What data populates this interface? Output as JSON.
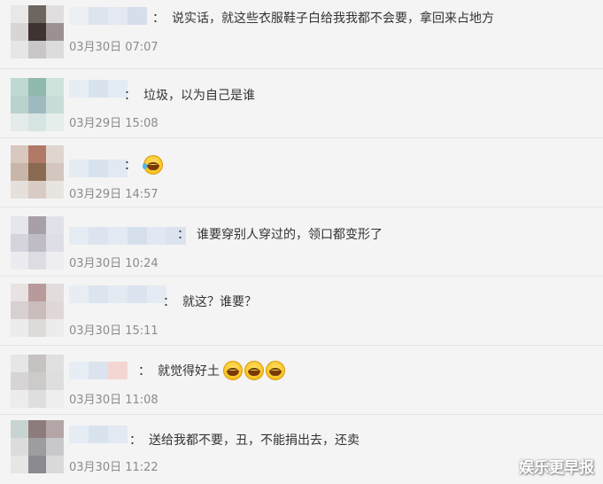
{
  "comments": [
    {
      "text": "说实话，就这些衣服鞋子白给我我都不会要，拿回来占地方",
      "time": "03月30日 07:07"
    },
    {
      "text": "垃圾，以为自己是谁",
      "time": "03月29日 15:08"
    },
    {
      "text": "",
      "time": "03月29日 14:57",
      "emoji_count": 1
    },
    {
      "text": "谁要穿别人穿过的，领口都变形了",
      "time": "03月30日 10:24"
    },
    {
      "text": "就这？谁要？",
      "time": "03月30日 15:11"
    },
    {
      "text": "就觉得好土",
      "time": "03月30日 11:08",
      "emoji_count": 3
    },
    {
      "text": "送给我都不要，丑，不能捐出去，还卖",
      "time": "03月30日 11:22"
    }
  ],
  "colon": "：",
  "watermark": "娱乐更早报"
}
